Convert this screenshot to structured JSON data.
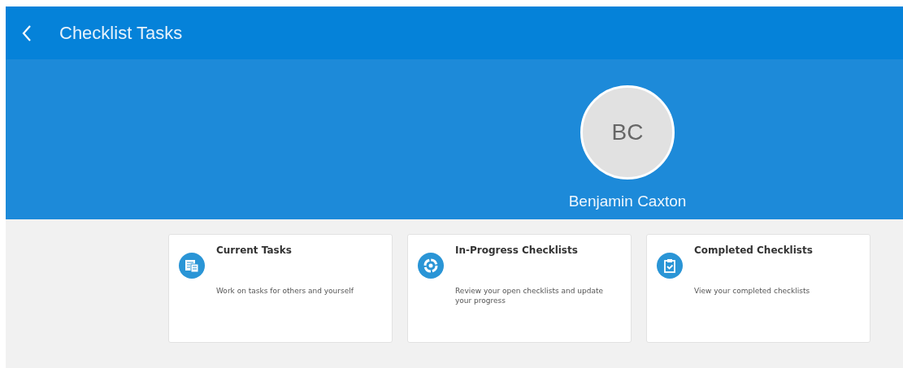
{
  "header": {
    "title": "Checklist Tasks"
  },
  "profile": {
    "initials": "BC",
    "name": "Benjamin Caxton"
  },
  "cards": [
    {
      "title": "Current Tasks",
      "description": "Work on tasks for others and yourself"
    },
    {
      "title": "In-Progress Checklists",
      "description": "Review your open checklists and update your progress"
    },
    {
      "title": "Completed Checklists",
      "description": "View your completed checklists"
    }
  ]
}
